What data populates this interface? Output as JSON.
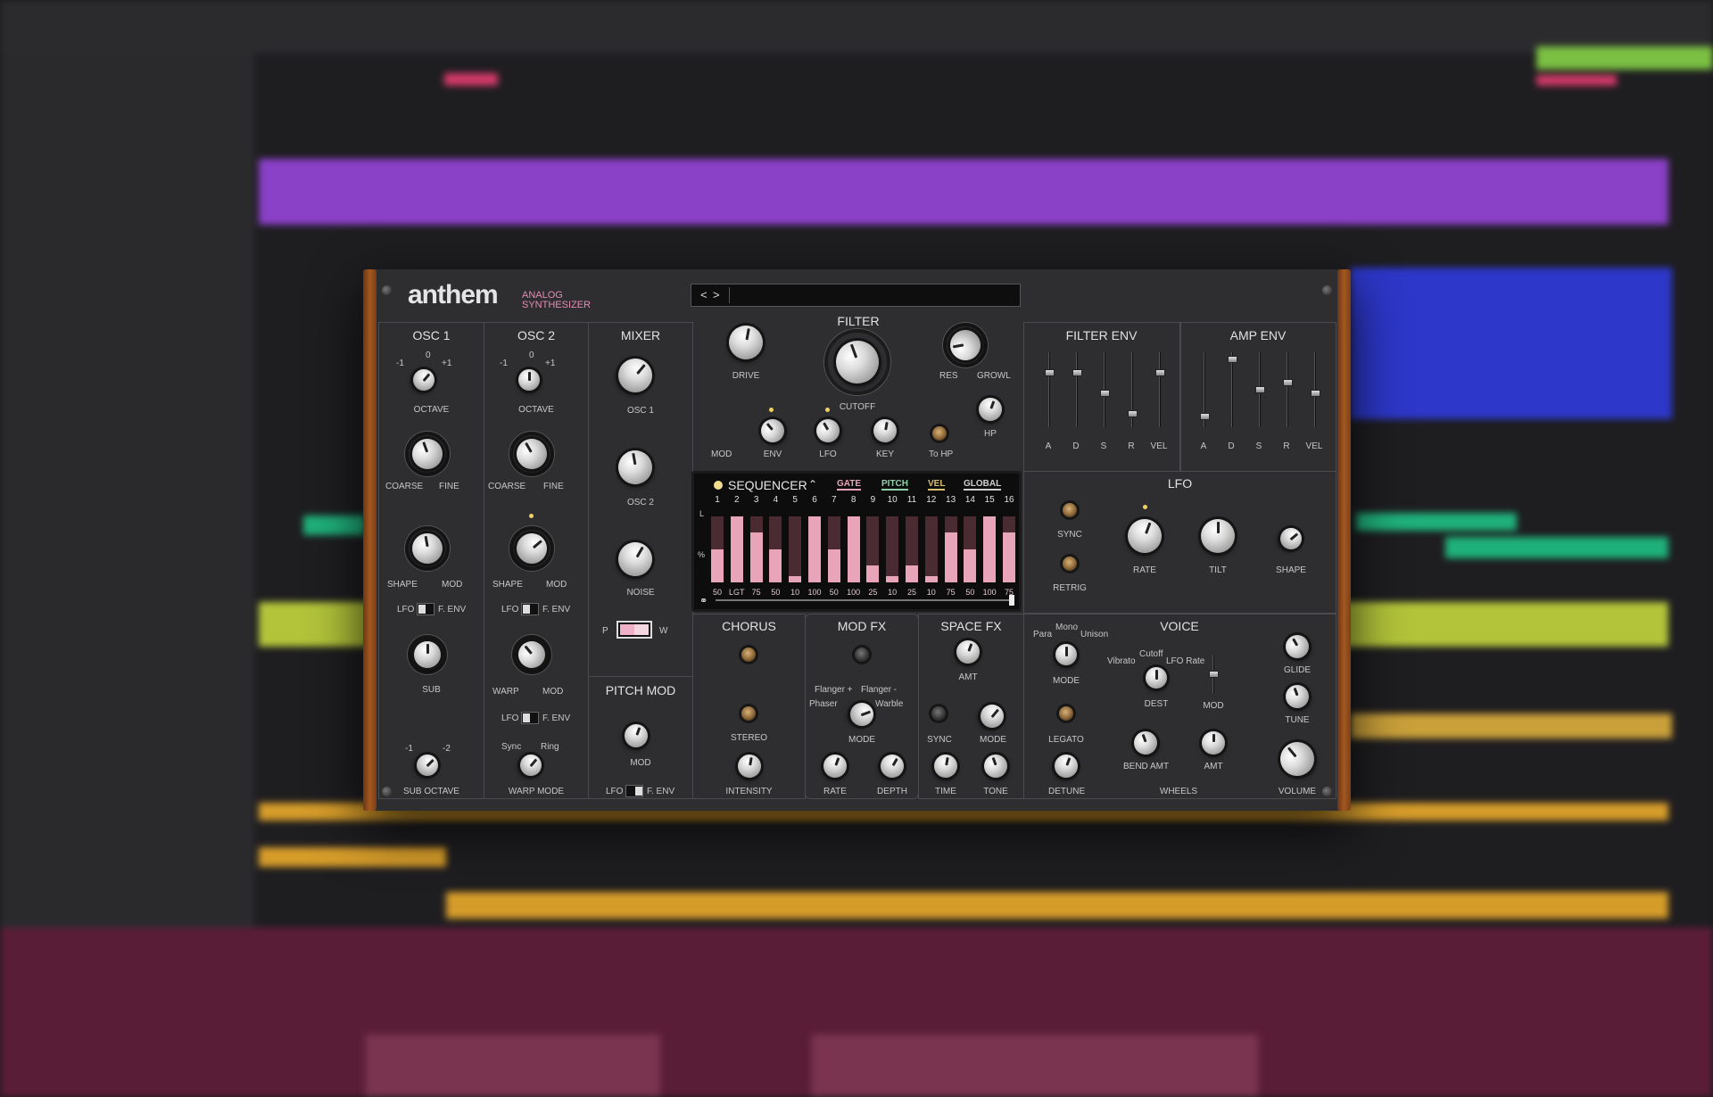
{
  "app": {
    "brand": "anthem",
    "subtitle_1": "ANALOG",
    "subtitle_2": "SYNTHESIZER"
  },
  "preset": {
    "nav_prev": "<",
    "nav_next": ">",
    "name": ""
  },
  "osc1": {
    "title": "OSC 1",
    "oct_m1": "-1",
    "oct_0": "0",
    "oct_p1": "+1",
    "octave": "OCTAVE",
    "coarse": "COARSE",
    "fine": "FINE",
    "shape": "SHAPE",
    "mod": "MOD",
    "lfo": "LFO",
    "fenv": "F. ENV",
    "sub": "SUB",
    "subm1": "-1",
    "subm2": "-2",
    "sub_octave": "SUB OCTAVE"
  },
  "osc2": {
    "title": "OSC 2",
    "oct_m1": "-1",
    "oct_0": "0",
    "oct_p1": "+1",
    "octave": "OCTAVE",
    "coarse": "COARSE",
    "fine": "FINE",
    "shape": "SHAPE",
    "mod": "MOD",
    "lfo": "LFO",
    "fenv": "F. ENV",
    "warp": "WARP",
    "warp_mod": "MOD",
    "lfo2": "LFO",
    "fenv2": "F. ENV",
    "sync": "Sync",
    "ring": "Ring",
    "warp_mode": "WARP MODE"
  },
  "mixer": {
    "title": "MIXER",
    "osc1": "OSC 1",
    "osc2": "OSC 2",
    "noise": "NOISE",
    "p": "P",
    "w": "W"
  },
  "pitchmod": {
    "title": "PITCH MOD",
    "mod": "MOD",
    "lfo": "LFO",
    "fenv": "F. ENV"
  },
  "filter": {
    "title": "FILTER",
    "drive": "DRIVE",
    "cutoff": "CUTOFF",
    "res": "RES",
    "growl": "GROWL",
    "mod": "MOD",
    "env": "ENV",
    "lfo": "LFO",
    "key": "KEY",
    "tohp": "To HP",
    "hp": "HP"
  },
  "filterenv": {
    "title": "FILTER ENV",
    "labels": [
      "A",
      "D",
      "S",
      "R",
      "VEL"
    ],
    "levels": [
      0.75,
      0.75,
      0.45,
      0.15,
      0.75
    ]
  },
  "ampenv": {
    "title": "AMP ENV",
    "labels": [
      "A",
      "D",
      "S",
      "R",
      "VEL"
    ],
    "levels": [
      0.1,
      0.95,
      0.5,
      0.6,
      0.45
    ]
  },
  "lfo": {
    "title": "LFO",
    "sync": "SYNC",
    "retrig": "RETRIG",
    "rate": "RATE",
    "tilt": "TILT",
    "shape": "SHAPE"
  },
  "sequencer": {
    "title": "SEQUENCER",
    "tabs": [
      "GATE",
      "PITCH",
      "VEL",
      "GLOBAL"
    ],
    "tab_colors": [
      "#e8a4b8",
      "#8fd0a8",
      "#d8c070",
      "#cfcfcf"
    ],
    "axis_l": "L",
    "axis_pct": "%",
    "steps": [
      "1",
      "2",
      "3",
      "4",
      "5",
      "6",
      "7",
      "8",
      "9",
      "10",
      "11",
      "12",
      "13",
      "14",
      "15",
      "16"
    ],
    "values": [
      "50",
      "LGT",
      "75",
      "50",
      "10",
      "100",
      "50",
      "100",
      "25",
      "10",
      "25",
      "10",
      "75",
      "50",
      "100",
      "75"
    ],
    "gate": [
      50,
      100,
      75,
      50,
      10,
      100,
      50,
      100,
      25,
      10,
      25,
      10,
      75,
      50,
      100,
      75
    ]
  },
  "chorus": {
    "title": "CHORUS",
    "stereo": "STEREO",
    "intensity": "INTENSITY"
  },
  "modfx": {
    "title": "MOD FX",
    "flanger_plus": "Flanger +",
    "phaser": "Phaser",
    "flanger_minus": "Flanger -",
    "warble": "Warble",
    "mode": "MODE",
    "rate": "RATE",
    "depth": "DEPTH"
  },
  "spacefx": {
    "title": "SPACE FX",
    "amt": "AMT",
    "sync": "SYNC",
    "mode": "MODE",
    "time": "TIME",
    "tone": "TONE"
  },
  "voice": {
    "title": "VOICE",
    "para": "Para",
    "mono": "Mono",
    "unison": "Unison",
    "mode": "MODE",
    "legato": "LEGATO",
    "detune": "DETUNE",
    "vibrato": "Vibrato",
    "cutoff": "Cutoff",
    "lforate": "LFO Rate",
    "dest": "DEST",
    "mod": "MOD",
    "bend_amt": "BEND AMT",
    "amt": "AMT",
    "wheels": "WHEELS",
    "glide": "GLIDE",
    "tune": "TUNE",
    "volume": "VOLUME"
  },
  "colors": {
    "accent": "#e8a4b8",
    "panel": "#2e2e31",
    "wood": "#8a4a1c"
  }
}
